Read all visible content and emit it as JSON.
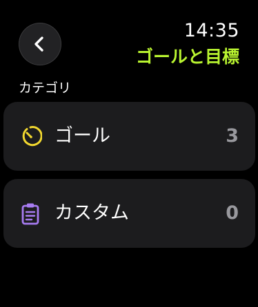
{
  "header": {
    "back_icon": "chevron-left-icon",
    "time": "14:35",
    "title": "ゴールと目標"
  },
  "section": {
    "label": "カテゴリ"
  },
  "categories": [
    {
      "label": "ゴール",
      "count": "3",
      "icon": "timer-icon"
    },
    {
      "label": "カスタム",
      "count": "0",
      "icon": "clipboard-icon"
    }
  ],
  "colors": {
    "background": "#000000",
    "accent_title": "#b9f430",
    "row_background": "#1c1c1e",
    "button_background": "#222224",
    "goal_icon": "#f2d82f",
    "custom_icon": "#a87cf2",
    "count": "#98989d"
  }
}
